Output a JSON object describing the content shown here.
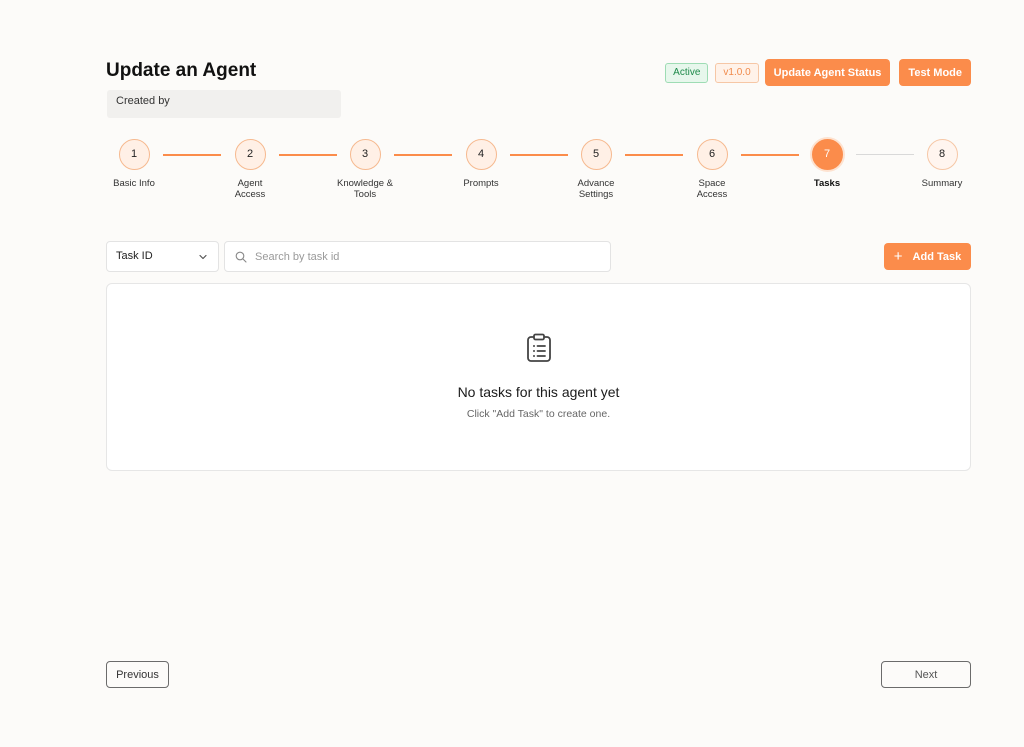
{
  "header": {
    "title": "Update an Agent",
    "created_by_label": "Created by",
    "status_badge": "Active",
    "version_badge": "v1.0.0",
    "update_status_button": "Update Agent Status",
    "test_mode_button": "Test Mode"
  },
  "stepper": {
    "steps": [
      {
        "number": "1",
        "label": "Basic Info",
        "state": "completed"
      },
      {
        "number": "2",
        "label": "Agent Access",
        "state": "completed"
      },
      {
        "number": "3",
        "label": "Knowledge & Tools",
        "state": "completed"
      },
      {
        "number": "4",
        "label": "Prompts",
        "state": "completed"
      },
      {
        "number": "5",
        "label": "Advance Settings",
        "state": "completed"
      },
      {
        "number": "6",
        "label": "Space Access",
        "state": "completed"
      },
      {
        "number": "7",
        "label": "Tasks",
        "state": "active"
      },
      {
        "number": "8",
        "label": "Summary",
        "state": "upcoming"
      }
    ]
  },
  "toolbar": {
    "filter_selected": "Task ID",
    "search_placeholder": "Search by task id",
    "add_task_button": "Add Task"
  },
  "empty_state": {
    "title": "No tasks for this agent yet",
    "subtitle": "Click \"Add Task\" to create one."
  },
  "footer": {
    "previous_button": "Previous",
    "next_button": "Next"
  },
  "colors": {
    "accent": "#fb8c4b",
    "active_green": "#1e8a4a",
    "background": "#fcfbf9"
  }
}
